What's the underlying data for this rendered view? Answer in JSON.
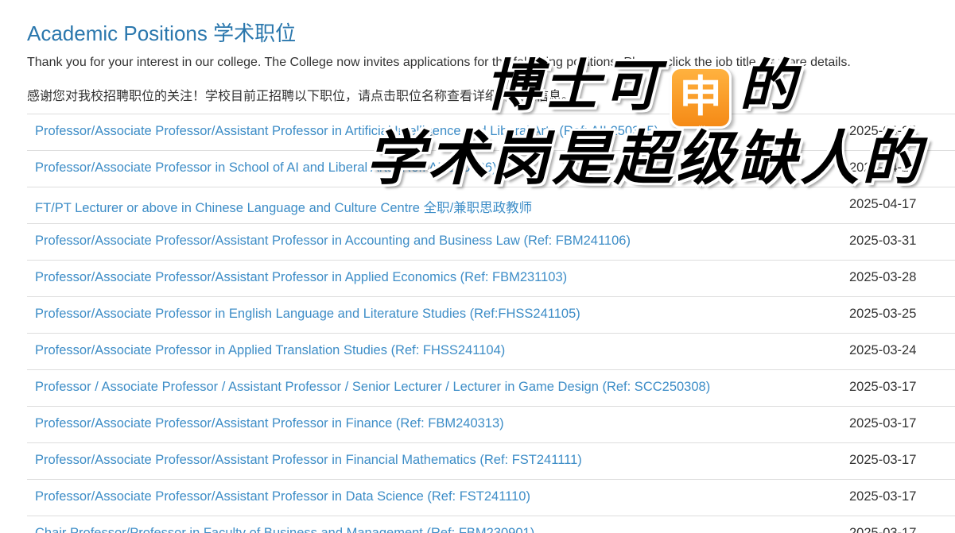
{
  "page": {
    "title": "Academic Positions 学术职位",
    "intro_en": "Thank you for your interest in our college. The College now invites applications for the following positions. Please click the job title for more details.",
    "intro_zh": "感谢您对我校招聘职位的关注！学校目前正招聘以下职位，请点击职位名称查看详细的职位信息。"
  },
  "jobs": [
    {
      "title": "Professor/Associate Professor/Assistant Professor in Artificial Intelligence and Liberal Arts (Ref: AIL250305)",
      "date": "2025-04-25"
    },
    {
      "title": "Professor/Associate Professor in School of AI and Liberal Arts (Ref: AIL250306)",
      "date": "2025-04-25"
    },
    {
      "title": "FT/PT Lecturer or above in Chinese Language and Culture Centre 全职/兼职思政教师",
      "date": "2025-04-17"
    },
    {
      "title": "Professor/Associate Professor/Assistant Professor in Accounting and Business Law (Ref: FBM241106)",
      "date": "2025-03-31"
    },
    {
      "title": "Professor/Associate Professor/Assistant Professor in Applied Economics (Ref: FBM231103)",
      "date": "2025-03-28"
    },
    {
      "title": "Professor/Associate Professor in English Language and Literature Studies (Ref:FHSS241105)",
      "date": "2025-03-25"
    },
    {
      "title": "Professor/Associate Professor in Applied Translation Studies (Ref: FHSS241104)",
      "date": "2025-03-24"
    },
    {
      "title": "Professor / Associate Professor / Assistant Professor / Senior Lecturer / Lecturer in Game Design (Ref: SCC250308)",
      "date": "2025-03-17"
    },
    {
      "title": "Professor/Associate Professor/Assistant Professor in Finance (Ref: FBM240313)",
      "date": "2025-03-17"
    },
    {
      "title": "Professor/Associate Professor/Assistant Professor in Financial Mathematics (Ref: FST241111)",
      "date": "2025-03-17"
    },
    {
      "title": "Professor/Associate Professor/Assistant Professor in Data Science (Ref: FST241110)",
      "date": "2025-03-17"
    },
    {
      "title": "Chair Professor/Professor in Faculty of Business and Management (Ref: FBM230901)",
      "date": "2025-03-17"
    }
  ],
  "overlay": {
    "line1_before": "博士可",
    "line1_emoji": "申",
    "line1_after": "的",
    "line2": "学术岗是超级缺人的",
    "emoji_color": "#f58a16"
  }
}
